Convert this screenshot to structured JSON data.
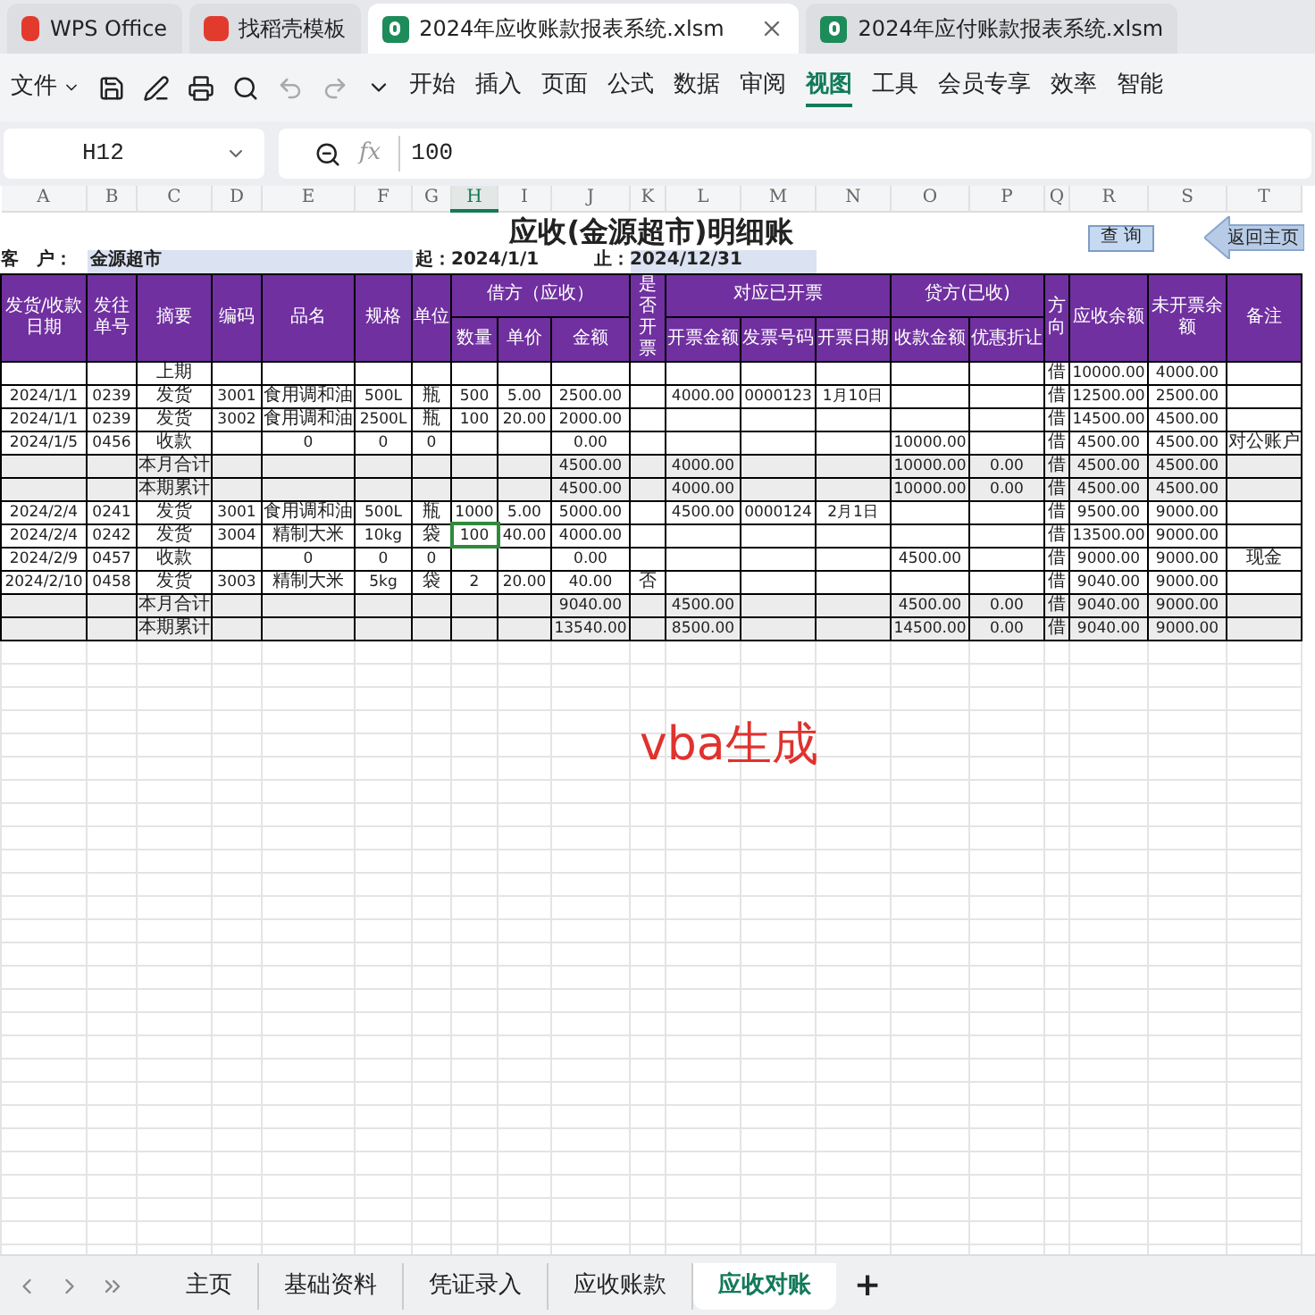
{
  "app_tabs": [
    {
      "label": "WPS Office",
      "kind": "home",
      "selected": false
    },
    {
      "label": "找稻壳模板",
      "kind": "template",
      "selected": false
    },
    {
      "label": "2024年应收账款报表系统.xlsm",
      "kind": "sheet",
      "selected": true
    },
    {
      "label": "2024年应付账款报表系统.xlsm",
      "kind": "sheet",
      "selected": false
    }
  ],
  "menu": {
    "file": "文件",
    "items": [
      {
        "label": "开始",
        "selected": false
      },
      {
        "label": "插入",
        "selected": false
      },
      {
        "label": "页面",
        "selected": false
      },
      {
        "label": "公式",
        "selected": false
      },
      {
        "label": "数据",
        "selected": false
      },
      {
        "label": "审阅",
        "selected": false
      },
      {
        "label": "视图",
        "selected": true
      },
      {
        "label": "工具",
        "selected": false
      },
      {
        "label": "会员专享",
        "selected": false
      },
      {
        "label": "效率",
        "selected": false
      },
      {
        "label": "智能",
        "selected": false
      }
    ]
  },
  "formula_bar": {
    "cell_ref": "H12",
    "fx": "fx",
    "value": "100"
  },
  "sheet": {
    "columns": [
      {
        "label": "A",
        "selected": false
      },
      {
        "label": "B",
        "selected": false
      },
      {
        "label": "C",
        "selected": false
      },
      {
        "label": "D",
        "selected": false
      },
      {
        "label": "E",
        "selected": false
      },
      {
        "label": "F",
        "selected": false
      },
      {
        "label": "G",
        "selected": false
      },
      {
        "label": "H",
        "selected": true
      },
      {
        "label": "I",
        "selected": false
      },
      {
        "label": "J",
        "selected": false
      },
      {
        "label": "K",
        "selected": false
      },
      {
        "label": "L",
        "selected": false
      },
      {
        "label": "M",
        "selected": false
      },
      {
        "label": "N",
        "selected": false
      },
      {
        "label": "O",
        "selected": false
      },
      {
        "label": "P",
        "selected": false
      },
      {
        "label": "Q",
        "selected": false
      },
      {
        "label": "R",
        "selected": false
      },
      {
        "label": "S",
        "selected": false
      },
      {
        "label": "T",
        "selected": false
      }
    ],
    "title": "应收(金源超市)明细账",
    "buttons": [
      {
        "label": "查 询",
        "kind": "button"
      },
      {
        "label": "返回主页",
        "kind": "arrow"
      }
    ],
    "customer": {
      "label": "客　户：",
      "value": "金源超市",
      "start_label": "起：",
      "start": "2024/1/1",
      "end_label": "止：",
      "end": "2024/12/31"
    },
    "header": [
      {
        "label": "发货/收款日期",
        "kind": "single"
      },
      {
        "label": "发往单号",
        "kind": "single"
      },
      {
        "label": "摘要",
        "kind": "single"
      },
      {
        "label": "编码",
        "kind": "single"
      },
      {
        "label": "品名",
        "kind": "single"
      },
      {
        "label": "规格",
        "kind": "single"
      },
      {
        "label": "单位",
        "kind": "single"
      },
      {
        "label": "借方（应收）",
        "kind": "group",
        "sub": [
          "数量",
          "单价",
          "金额"
        ]
      },
      {
        "label": "是否开票",
        "kind": "single"
      },
      {
        "label": "对应已开票",
        "kind": "group",
        "sub": [
          "开票金额",
          "发票号码",
          "开票日期"
        ]
      },
      {
        "label": "贷方(已收)",
        "kind": "group",
        "sub": [
          "收款金额",
          "优惠折让"
        ]
      },
      {
        "label": "方向",
        "kind": "single"
      },
      {
        "label": "应收余额",
        "kind": "single"
      },
      {
        "label": "未开票余额",
        "kind": "single"
      },
      {
        "label": "备注",
        "kind": "single"
      }
    ],
    "rows": [
      {
        "shaded": false,
        "cells": {
          "C": "上期",
          "Q": "借",
          "R": "10000.00",
          "S": "4000.00"
        }
      },
      {
        "shaded": false,
        "cells": {
          "A": "2024/1/1",
          "B": "0239",
          "C": "发货",
          "D": "3001",
          "E": "食用调和油",
          "F": "500L",
          "G": "瓶",
          "H": "500",
          "I": "5.00",
          "J": "2500.00",
          "L": "4000.00",
          "M": "0000123",
          "N": "1月10日",
          "Q": "借",
          "R": "12500.00",
          "S": "2500.00"
        }
      },
      {
        "shaded": false,
        "cells": {
          "A": "2024/1/1",
          "B": "0239",
          "C": "发货",
          "D": "3002",
          "E": "食用调和油",
          "F": "2500L",
          "G": "瓶",
          "H": "100",
          "I": "20.00",
          "J": "2000.00",
          "Q": "借",
          "R": "14500.00",
          "S": "4500.00"
        }
      },
      {
        "shaded": false,
        "cells": {
          "A": "2024/1/5",
          "B": "0456",
          "C": "收款",
          "E": "0",
          "F": "0",
          "G": "0",
          "J": "0.00",
          "O": "10000.00",
          "Q": "借",
          "R": "4500.00",
          "S": "4500.00",
          "T": "对公账户"
        }
      },
      {
        "shaded": true,
        "cells": {
          "C": "本月合计",
          "J": "4500.00",
          "L": "4000.00",
          "O": "10000.00",
          "P": "0.00",
          "Q": "借",
          "R": "4500.00",
          "S": "4500.00"
        }
      },
      {
        "shaded": true,
        "cells": {
          "C": "本期累计",
          "J": "4500.00",
          "L": "4000.00",
          "O": "10000.00",
          "P": "0.00",
          "Q": "借",
          "R": "4500.00",
          "S": "4500.00"
        }
      },
      {
        "shaded": false,
        "cells": {
          "A": "2024/2/4",
          "B": "0241",
          "C": "发货",
          "D": "3001",
          "E": "食用调和油",
          "F": "500L",
          "G": "瓶",
          "H": "1000",
          "I": "5.00",
          "J": "5000.00",
          "L": "4500.00",
          "M": "0000124",
          "N": "2月1日",
          "Q": "借",
          "R": "9500.00",
          "S": "9000.00"
        }
      },
      {
        "shaded": false,
        "selected": true,
        "cells": {
          "A": "2024/2/4",
          "B": "0242",
          "C": "发货",
          "D": "3004",
          "E": "精制大米",
          "F": "10kg",
          "G": "袋",
          "H": "100",
          "I": "40.00",
          "J": "4000.00",
          "Q": "借",
          "R": "13500.00",
          "S": "9000.00"
        }
      },
      {
        "shaded": false,
        "cells": {
          "A": "2024/2/9",
          "B": "0457",
          "C": "收款",
          "E": "0",
          "F": "0",
          "G": "0",
          "J": "0.00",
          "O": "4500.00",
          "Q": "借",
          "R": "9000.00",
          "S": "9000.00",
          "T": "现金"
        }
      },
      {
        "shaded": false,
        "cells": {
          "A": "2024/2/10",
          "B": "0458",
          "C": "发货",
          "D": "3003",
          "E": "精制大米",
          "F": "5kg",
          "G": "袋",
          "H": "2",
          "I": "20.00",
          "J": "40.00",
          "K": "否",
          "Q": "借",
          "R": "9040.00",
          "S": "9000.00"
        }
      },
      {
        "shaded": true,
        "cells": {
          "C": "本月合计",
          "J": "9040.00",
          "L": "4500.00",
          "O": "4500.00",
          "P": "0.00",
          "Q": "借",
          "R": "9040.00",
          "S": "9000.00"
        }
      },
      {
        "shaded": true,
        "cells": {
          "C": "本期累计",
          "J": "13540.00",
          "L": "8500.00",
          "O": "14500.00",
          "P": "0.00",
          "Q": "借",
          "R": "9040.00",
          "S": "9000.00"
        }
      }
    ],
    "note": "vba生成"
  },
  "sheet_tabs": [
    {
      "label": "主页",
      "selected": false
    },
    {
      "label": "基础资料",
      "selected": false
    },
    {
      "label": "凭证录入",
      "selected": false
    },
    {
      "label": "应收账款",
      "selected": false
    },
    {
      "label": "应收对账",
      "selected": true
    }
  ],
  "add_sheet": "+"
}
